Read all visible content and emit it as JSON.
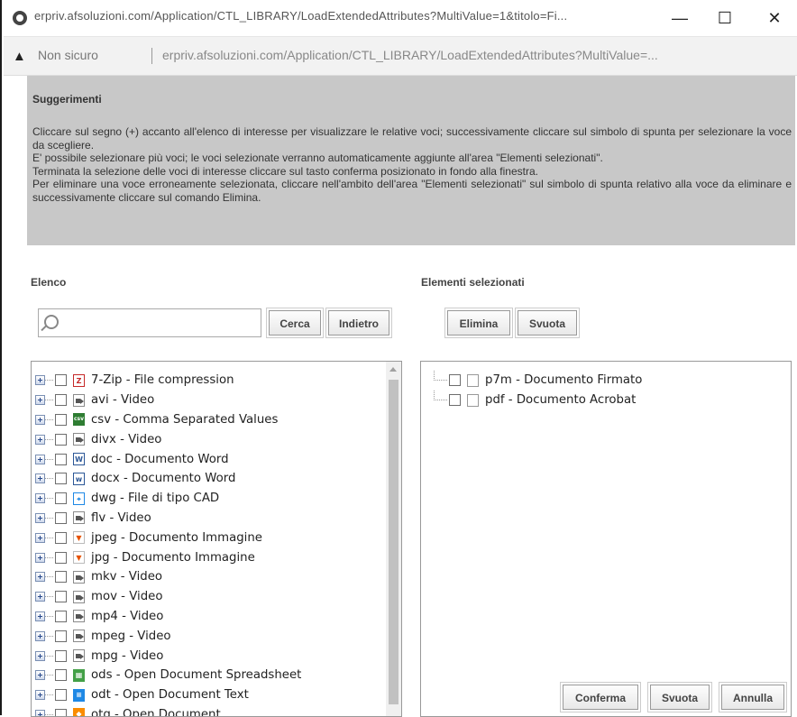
{
  "window": {
    "title": "erpriv.afsoluzioni.com/Application/CTL_LIBRARY/LoadExtendedAttributes?MultiValue=1&titolo=Fi...",
    "minimize": "—",
    "maximize": "☐",
    "close": "✕"
  },
  "addressbar": {
    "warning_icon": "▲",
    "security": "Non sicuro",
    "url": "erpriv.afsoluzioni.com/Application/CTL_LIBRARY/LoadExtendedAttributes?MultiValue=..."
  },
  "suggestions": {
    "title": "Suggerimenti",
    "lines": [
      "Cliccare sul segno (+) accanto all'elenco di interesse per visualizzare le relative voci; successivamente cliccare sul simbolo di spunta per selezionare la voce da scegliere.",
      "E' possibile selezionare più voci; le voci selezionate verranno automaticamente aggiunte all'area \"Elementi selezionati\".",
      "Terminata la selezione delle voci di interesse cliccare sul tasto conferma posizionato in fondo alla finestra.",
      "Per eliminare una voce erroneamente selezionata, cliccare nell'ambito dell'area \"Elementi selezionati\" sul simbolo di spunta relativo alla voce da eliminare e successivamente cliccare sul comando Elimina."
    ]
  },
  "left": {
    "label": "Elenco",
    "search": {
      "value": "",
      "placeholder": ""
    },
    "search_button": "Cerca",
    "back_button": "Indietro",
    "items": [
      {
        "label": "7-Zip - File compression",
        "icon": "zip",
        "glyph": "Z"
      },
      {
        "label": "avi - Video",
        "icon": "video",
        "glyph": ""
      },
      {
        "label": "csv - Comma Separated Values",
        "icon": "csv",
        "glyph": "csv"
      },
      {
        "label": "divx - Video",
        "icon": "video",
        "glyph": ""
      },
      {
        "label": "doc - Documento Word",
        "icon": "doc",
        "glyph": "W"
      },
      {
        "label": "docx - Documento Word",
        "icon": "docx",
        "glyph": "w"
      },
      {
        "label": "dwg - File di tipo CAD",
        "icon": "dwg",
        "glyph": "⌖"
      },
      {
        "label": "flv - Video",
        "icon": "video",
        "glyph": ""
      },
      {
        "label": "jpeg - Documento Immagine",
        "icon": "img",
        "glyph": "▼"
      },
      {
        "label": "jpg - Documento Immagine",
        "icon": "img",
        "glyph": "▼"
      },
      {
        "label": "mkv - Video",
        "icon": "video",
        "glyph": ""
      },
      {
        "label": "mov - Video",
        "icon": "video",
        "glyph": ""
      },
      {
        "label": "mp4 - Video",
        "icon": "video",
        "glyph": ""
      },
      {
        "label": "mpeg - Video",
        "icon": "video",
        "glyph": ""
      },
      {
        "label": "mpg - Video",
        "icon": "video",
        "glyph": ""
      },
      {
        "label": "ods - Open Document Spreadsheet",
        "icon": "ods",
        "glyph": "▦"
      },
      {
        "label": "odt - Open Document Text",
        "icon": "odt",
        "glyph": "≡"
      },
      {
        "label": "otg - Open Document",
        "icon": "otg",
        "glyph": "◆"
      }
    ]
  },
  "right": {
    "label": "Elementi selezionati",
    "delete_button": "Elimina",
    "clear_button": "Svuota",
    "items": [
      {
        "label": "p7m - Documento Firmato"
      },
      {
        "label": "pdf - Documento Acrobat"
      }
    ]
  },
  "footer": {
    "confirm": "Conferma",
    "clear": "Svuota",
    "cancel": "Annulla"
  }
}
